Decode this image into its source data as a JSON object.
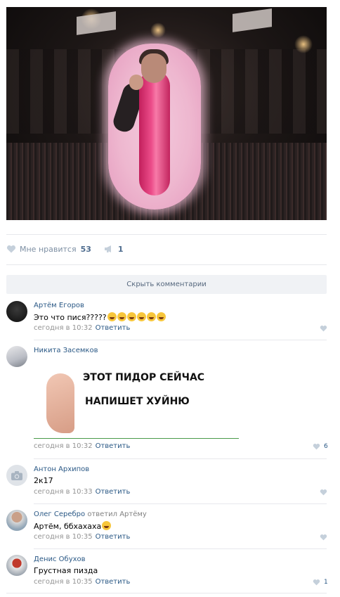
{
  "post": {
    "likes_label": "Мне нравится",
    "likes_count": "53",
    "shares_count": "1"
  },
  "hide_comments_label": "Скрыть комментарии",
  "reply_label": "Ответить",
  "comments": [
    {
      "author": "Артём Егоров",
      "text": "Это что пися?????",
      "time": "сегодня в 10:32",
      "likes": ""
    },
    {
      "author": "Никита Засемков",
      "text": "",
      "time": "сегодня в 10:32",
      "likes": "6",
      "image_text": [
        "ЭТОТ ПИДОР СЕЙЧАС",
        "НАПИШЕТ ХУЙНЮ"
      ]
    },
    {
      "author": "Антон Архипов",
      "text": "2к17",
      "time": "сегодня в 10:33",
      "likes": ""
    },
    {
      "author": "Олег Серебро",
      "reply_to": "ответил Артёму",
      "text": "Артём, ббхахаха",
      "time": "сегодня в 10:35",
      "likes": ""
    },
    {
      "author": "Денис Обухов",
      "text": "Грустная пизда",
      "time": "сегодня в 10:35",
      "likes": "1"
    }
  ],
  "colors": {
    "link": "#2a5885",
    "muted": "#939393",
    "separator": "#e7e8ec",
    "button_bg": "#f0f2f5"
  }
}
